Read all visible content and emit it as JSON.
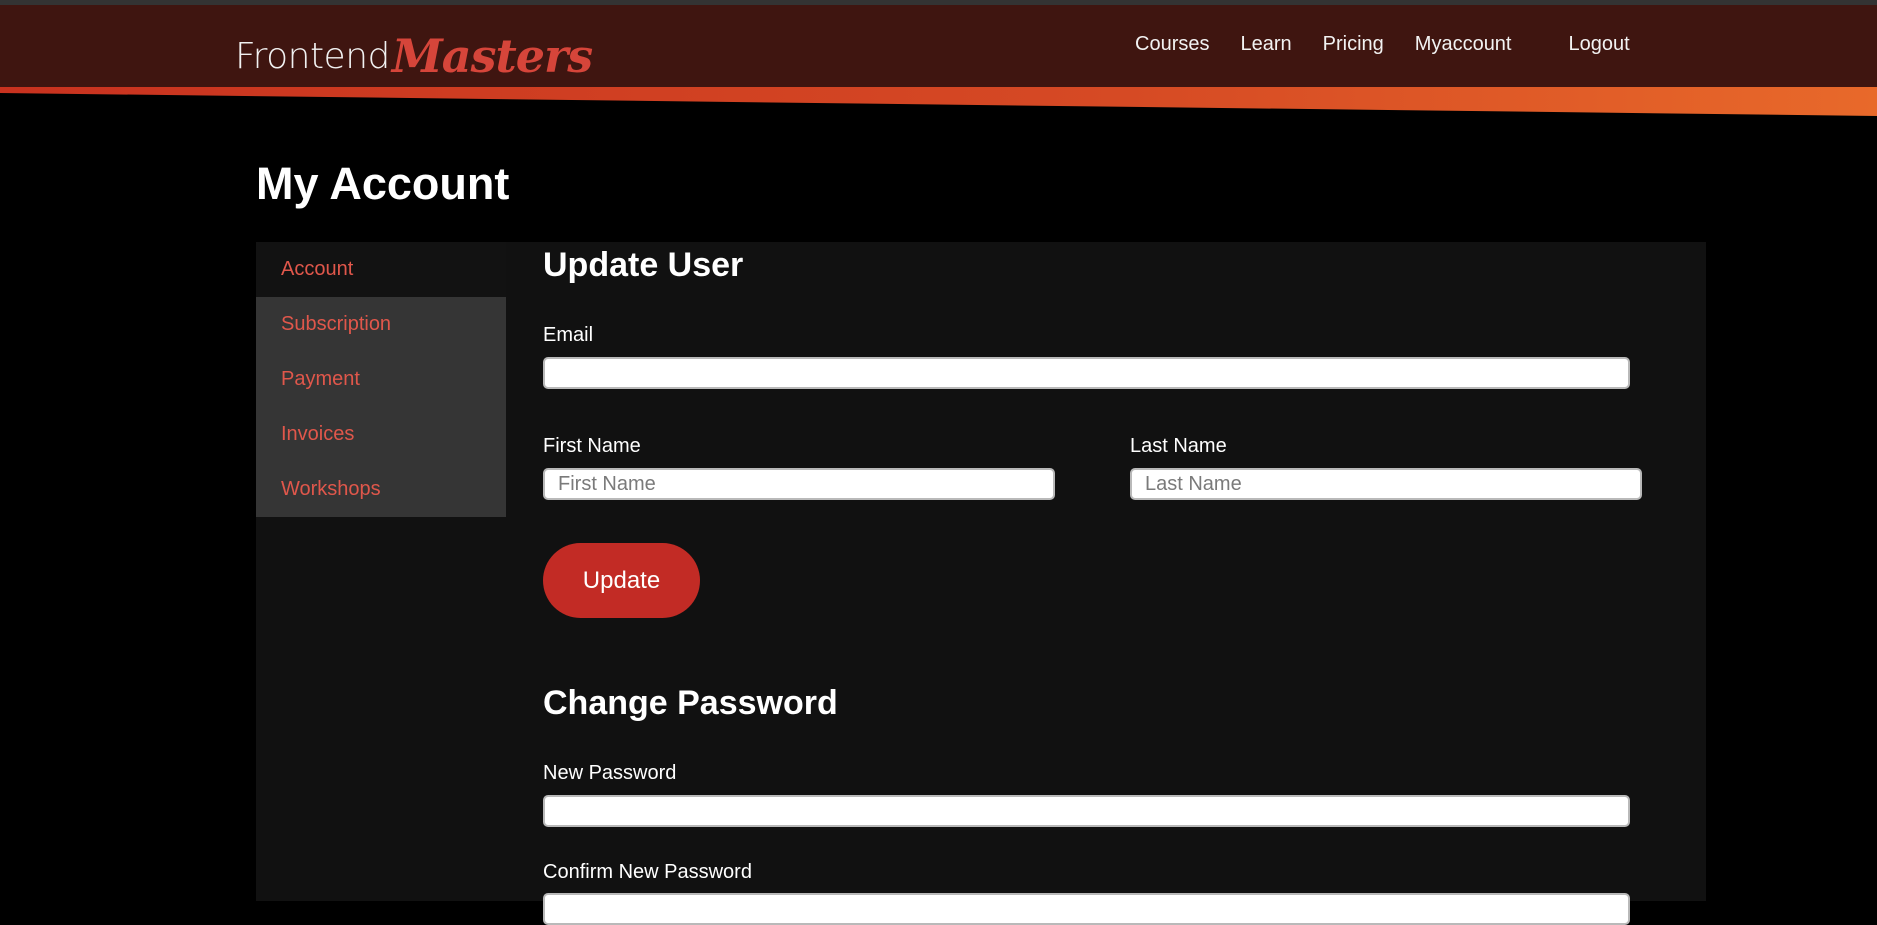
{
  "logo": {
    "part1": "Frontend",
    "part2": "Masters"
  },
  "nav": {
    "courses": "Courses",
    "learn": "Learn",
    "pricing": "Pricing",
    "myaccount": "Myaccount",
    "logout": "Logout"
  },
  "page": {
    "title": "My Account"
  },
  "sidebar": {
    "items": [
      {
        "label": "Account",
        "active": true
      },
      {
        "label": "Subscription"
      },
      {
        "label": "Payment"
      },
      {
        "label": "Invoices"
      },
      {
        "label": "Workshops"
      }
    ]
  },
  "update_user": {
    "heading": "Update User",
    "email_label": "Email",
    "email_value": "",
    "first_name_label": "First Name",
    "first_name_placeholder": "First Name",
    "last_name_label": "Last Name",
    "last_name_placeholder": "Last Name",
    "update_button": "Update"
  },
  "change_password": {
    "heading": "Change Password",
    "new_password_label": "New Password",
    "confirm_password_label": "Confirm New Password"
  },
  "colors": {
    "header_bg": "#3f1510",
    "accent": "#d6453a",
    "button": "#c22b25",
    "orange": "#e8692a"
  }
}
